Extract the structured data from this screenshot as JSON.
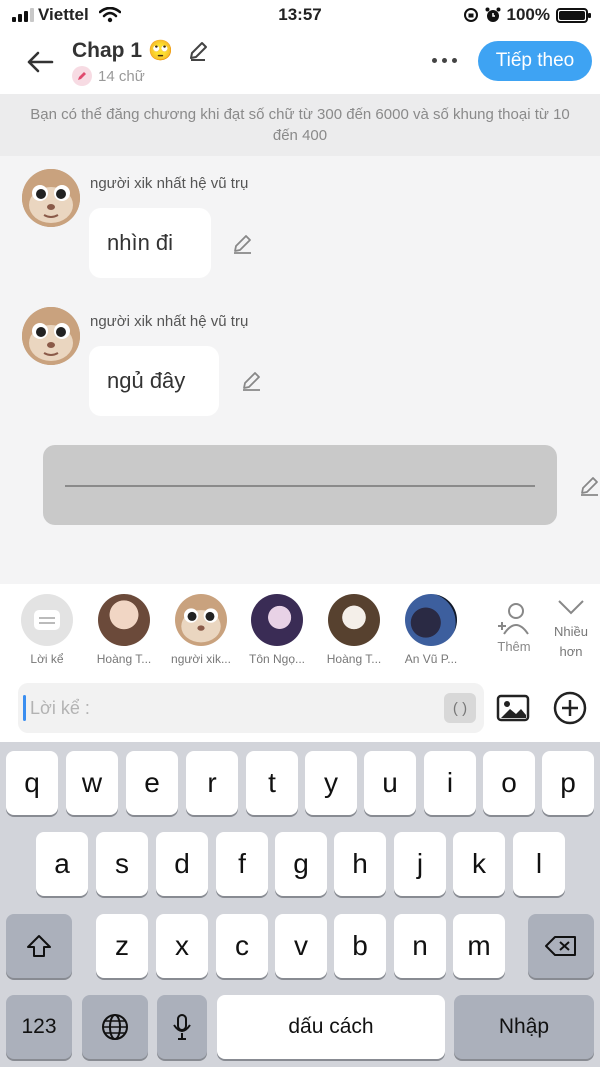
{
  "status": {
    "carrier": "Viettel",
    "time": "13:57",
    "battery": "100%"
  },
  "header": {
    "title": "Chap 1",
    "title_emoji": "🙄",
    "word_count": "14 chữ",
    "next_label": "Tiếp theo"
  },
  "notice": "Bạn có thể đăng chương khi đạt số chữ từ 300 đến 6000 và số khung thoại từ 10 đến 400",
  "messages": [
    {
      "sender": "người xik nhất hệ vũ trụ",
      "text": "nhìn đi"
    },
    {
      "sender": "người xik nhất hệ vũ trụ",
      "text": "ngủ đây"
    }
  ],
  "empty_bubble": "________________________________",
  "characters": [
    {
      "label": "Lời kể"
    },
    {
      "label": "Hoàng T..."
    },
    {
      "label": "người xik..."
    },
    {
      "label": "Tôn Ngọ..."
    },
    {
      "label": "Hoàng T..."
    },
    {
      "label": "An Vũ P..."
    }
  ],
  "add_character_label": "Thêm",
  "more_characters_label": "Nhiều hơn",
  "input": {
    "placeholder": "Lời kể :",
    "paren_label": "( )"
  },
  "keyboard": {
    "row1": [
      "q",
      "w",
      "e",
      "r",
      "t",
      "y",
      "u",
      "i",
      "o",
      "p"
    ],
    "row2": [
      "a",
      "s",
      "d",
      "f",
      "g",
      "h",
      "j",
      "k",
      "l"
    ],
    "row3": [
      "z",
      "x",
      "c",
      "v",
      "b",
      "n",
      "m"
    ],
    "numbers_label": "123",
    "space_label": "dấu cách",
    "return_label": "Nhập"
  },
  "colors": {
    "accent": "#3ea3f3",
    "caret": "#3a8ef0"
  }
}
